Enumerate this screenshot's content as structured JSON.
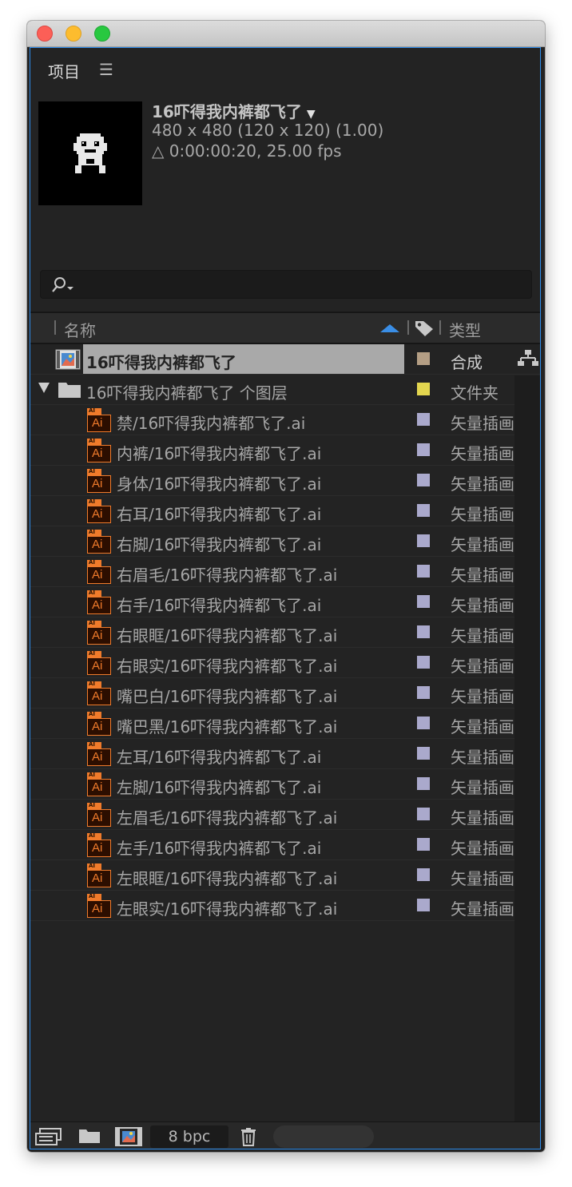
{
  "window": {
    "buttons": [
      "close",
      "minimize",
      "maximize"
    ]
  },
  "panel": {
    "title": "项目",
    "menu_icon": "hamburger-menu-icon"
  },
  "preview": {
    "name": "16吓得我内裤都飞了",
    "dimensions": "480 x 480  (120 x 120) (1.00)",
    "duration": "△ 0:00:00:20, 25.00 fps"
  },
  "search": {
    "icon": "search-icon",
    "value": ""
  },
  "columns": {
    "name": "名称",
    "type": "类型",
    "tag_icon": "label-tag-icon"
  },
  "rows": [
    {
      "kind": "comp",
      "name": "16吓得我内裤都飞了",
      "label_color": "#b49e84",
      "type": "合成",
      "selected": true
    },
    {
      "kind": "folder",
      "name": "16吓得我内裤都飞了 个图层",
      "label_color": "#e3d64f",
      "type": "文件夹"
    },
    {
      "kind": "ai",
      "name": "禁/16吓得我内裤都飞了.ai",
      "label_color": "#aaa9cc",
      "type": "矢量插画"
    },
    {
      "kind": "ai",
      "name": "内裤/16吓得我内裤都飞了.ai",
      "label_color": "#aaa9cc",
      "type": "矢量插画"
    },
    {
      "kind": "ai",
      "name": "身体/16吓得我内裤都飞了.ai",
      "label_color": "#aaa9cc",
      "type": "矢量插画"
    },
    {
      "kind": "ai",
      "name": "右耳/16吓得我内裤都飞了.ai",
      "label_color": "#aaa9cc",
      "type": "矢量插画"
    },
    {
      "kind": "ai",
      "name": "右脚/16吓得我内裤都飞了.ai",
      "label_color": "#aaa9cc",
      "type": "矢量插画"
    },
    {
      "kind": "ai",
      "name": "右眉毛/16吓得我内裤都飞了.ai",
      "label_color": "#aaa9cc",
      "type": "矢量插画"
    },
    {
      "kind": "ai",
      "name": "右手/16吓得我内裤都飞了.ai",
      "label_color": "#aaa9cc",
      "type": "矢量插画"
    },
    {
      "kind": "ai",
      "name": "右眼眶/16吓得我内裤都飞了.ai",
      "label_color": "#aaa9cc",
      "type": "矢量插画"
    },
    {
      "kind": "ai",
      "name": "右眼实/16吓得我内裤都飞了.ai",
      "label_color": "#aaa9cc",
      "type": "矢量插画"
    },
    {
      "kind": "ai",
      "name": "嘴巴白/16吓得我内裤都飞了.ai",
      "label_color": "#aaa9cc",
      "type": "矢量插画"
    },
    {
      "kind": "ai",
      "name": "嘴巴黑/16吓得我内裤都飞了.ai",
      "label_color": "#aaa9cc",
      "type": "矢量插画"
    },
    {
      "kind": "ai",
      "name": "左耳/16吓得我内裤都飞了.ai",
      "label_color": "#aaa9cc",
      "type": "矢量插画"
    },
    {
      "kind": "ai",
      "name": "左脚/16吓得我内裤都飞了.ai",
      "label_color": "#aaa9cc",
      "type": "矢量插画"
    },
    {
      "kind": "ai",
      "name": "左眉毛/16吓得我内裤都飞了.ai",
      "label_color": "#aaa9cc",
      "type": "矢量插画"
    },
    {
      "kind": "ai",
      "name": "左手/16吓得我内裤都飞了.ai",
      "label_color": "#aaa9cc",
      "type": "矢量插画"
    },
    {
      "kind": "ai",
      "name": "左眼眶/16吓得我内裤都飞了.ai",
      "label_color": "#aaa9cc",
      "type": "矢量插画"
    },
    {
      "kind": "ai",
      "name": "左眼实/16吓得我内裤都飞了.ai",
      "label_color": "#aaa9cc",
      "type": "矢量插画"
    }
  ],
  "ai_badge": {
    "tab": "AI",
    "label": "Ai"
  },
  "bottom_bar": {
    "icons": [
      "interpret-footage-icon",
      "new-folder-icon",
      "new-composition-icon",
      "delete-icon"
    ],
    "bit_depth": "8 bpc"
  },
  "colors": {
    "accent": "#2d8ceb",
    "ai_orange": "#f07b2b",
    "selection": "#a9a9a9"
  }
}
